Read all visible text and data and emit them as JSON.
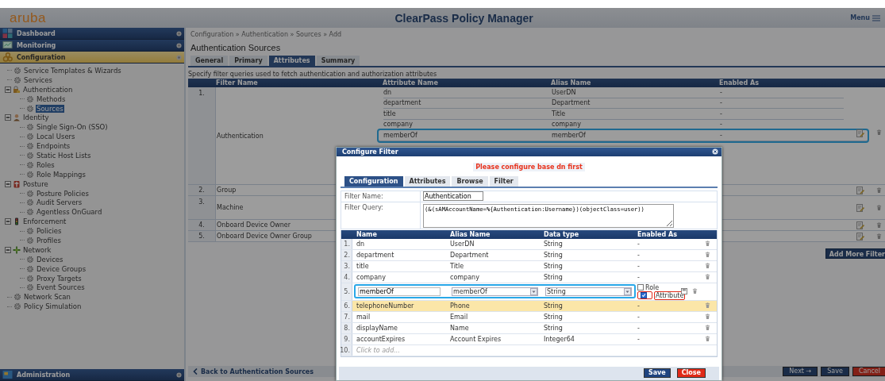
{
  "header": {
    "logo": "aruba",
    "title": "ClearPass Policy Manager",
    "menu": "Menu"
  },
  "nav": [
    {
      "label": "Dashboard",
      "selected": false
    },
    {
      "label": "Monitoring",
      "selected": false
    },
    {
      "label": "Configuration",
      "selected": true
    }
  ],
  "tree": [
    {
      "label": "Service Templates & Wizards",
      "selected": false
    },
    {
      "label": "Services",
      "selected": false
    },
    {
      "label": "Authentication",
      "selected": false,
      "expanded": true,
      "children": [
        {
          "label": "Methods",
          "selected": false
        },
        {
          "label": "Sources",
          "selected": true
        }
      ]
    },
    {
      "label": "Identity",
      "selected": false,
      "expanded": true,
      "children": [
        {
          "label": "Single Sign-On (SSO)",
          "selected": false
        },
        {
          "label": "Local Users",
          "selected": false
        },
        {
          "label": "Endpoints",
          "selected": false
        },
        {
          "label": "Static Host Lists",
          "selected": false
        },
        {
          "label": "Roles",
          "selected": false
        },
        {
          "label": "Role Mappings",
          "selected": false
        }
      ]
    },
    {
      "label": "Posture",
      "selected": false,
      "expanded": true,
      "children": [
        {
          "label": "Posture Policies",
          "selected": false
        },
        {
          "label": "Audit Servers",
          "selected": false
        },
        {
          "label": "Agentless OnGuard",
          "selected": false
        }
      ]
    },
    {
      "label": "Enforcement",
      "selected": false,
      "expanded": true,
      "children": [
        {
          "label": "Policies",
          "selected": false
        },
        {
          "label": "Profiles",
          "selected": false
        }
      ]
    },
    {
      "label": "Network",
      "selected": false,
      "expanded": true,
      "children": [
        {
          "label": "Devices",
          "selected": false
        },
        {
          "label": "Device Groups",
          "selected": false
        },
        {
          "label": "Proxy Targets",
          "selected": false
        },
        {
          "label": "Event Sources",
          "selected": false
        }
      ]
    },
    {
      "label": "Network Scan",
      "selected": false
    },
    {
      "label": "Policy Simulation",
      "selected": false
    }
  ],
  "nav_bottom": {
    "label": "Administration",
    "selected": false
  },
  "breadcrumb": "Configuration » Authentication » Sources » Add",
  "page_title": "Authentication Sources",
  "tabs": [
    {
      "label": "General",
      "selected": false
    },
    {
      "label": "Primary",
      "selected": false
    },
    {
      "label": "Attributes",
      "selected": true
    },
    {
      "label": "Summary",
      "selected": false
    }
  ],
  "description": "Specify filter queries used to fetch authentication and authorization attributes",
  "table": {
    "columns": [
      "Filter Name",
      "Attribute Name",
      "Alias Name",
      "Enabled As"
    ],
    "rows": [
      {
        "number": "1.",
        "filter_name": "Authentication",
        "attributes": [
          {
            "name": "dn",
            "alias": "UserDN",
            "enabled_as": "-",
            "highlighted": false
          },
          {
            "name": "department",
            "alias": "Department",
            "enabled_as": "-",
            "highlighted": false
          },
          {
            "name": "title",
            "alias": "Title",
            "enabled_as": "-",
            "highlighted": false
          },
          {
            "name": "company",
            "alias": "company",
            "enabled_as": "-",
            "highlighted": false
          },
          {
            "name": "memberOf",
            "alias": "memberOf",
            "enabled_as": "-",
            "highlighted": true
          }
        ]
      },
      {
        "number": "2.",
        "filter_name": "Group",
        "attributes": []
      },
      {
        "number": "3.",
        "filter_name": "Machine",
        "attributes": []
      },
      {
        "number": "4.",
        "filter_name": "Onboard Device Owner",
        "attributes": []
      },
      {
        "number": "5.",
        "filter_name": "Onboard Device Owner Group",
        "attributes": []
      }
    ]
  },
  "add_button": "Add More Filter",
  "back_link": "Back to Authentication Sources",
  "buttons": [
    {
      "label": "Next →",
      "kind": "next"
    },
    {
      "label": "Save",
      "kind": "save"
    },
    {
      "label": "Cancel",
      "kind": "cancel"
    }
  ],
  "dialog": {
    "title": "Configure Filter",
    "message": "Please configure base dn first",
    "tabs": [
      {
        "label": "Configuration",
        "selected": true
      },
      {
        "label": "Attributes",
        "selected": false
      },
      {
        "label": "Browse",
        "selected": false
      },
      {
        "label": "Filter",
        "selected": false
      }
    ],
    "filter_name_label": "Filter Name:",
    "filter_name": "Authentication",
    "filter_query_label": "Filter Query:",
    "filter_query": "(&(sAMAccountName=%{Authentication:Username})(objectClass=user))",
    "columns": [
      "Name",
      "Alias Name",
      "Data type",
      "Enabled As"
    ],
    "rows": [
      {
        "kind": "display",
        "number": "1.",
        "name": "dn",
        "alias": "UserDN",
        "data_type": "String",
        "enabled_as": "-",
        "selected": false
      },
      {
        "kind": "display",
        "number": "2.",
        "name": "department",
        "alias": "Department",
        "data_type": "String",
        "enabled_as": "-",
        "selected": false
      },
      {
        "kind": "display",
        "number": "3.",
        "name": "title",
        "alias": "Title",
        "data_type": "String",
        "enabled_as": "-",
        "selected": false
      },
      {
        "kind": "display",
        "number": "4.",
        "name": "company",
        "alias": "company",
        "data_type": "String",
        "enabled_as": "-",
        "selected": false
      },
      {
        "kind": "editing",
        "number": "5.",
        "name": "memberOf",
        "alias": "memberOf",
        "data_type": "String",
        "highlighted": true,
        "options": [
          {
            "label": "Role",
            "checked": false,
            "marked": false
          },
          {
            "label": "Attribute",
            "checked": true,
            "marked": true
          }
        ]
      },
      {
        "kind": "display",
        "number": "6.",
        "name": "telephoneNumber",
        "alias": "Phone",
        "data_type": "String",
        "enabled_as": "-",
        "selected": true
      },
      {
        "kind": "display",
        "number": "7.",
        "name": "mail",
        "alias": "Email",
        "data_type": "String",
        "enabled_as": "-",
        "selected": false
      },
      {
        "kind": "display",
        "number": "8.",
        "name": "displayName",
        "alias": "Name",
        "data_type": "String",
        "enabled_as": "-",
        "selected": false
      },
      {
        "kind": "display",
        "number": "9.",
        "name": "accountExpires",
        "alias": "Account Expires",
        "data_type": "Integer64",
        "enabled_as": "-",
        "selected": false
      },
      {
        "kind": "add",
        "number": "10.",
        "placeholder": "Click to add..."
      }
    ],
    "buttons": [
      {
        "label": "Save",
        "kind": "save"
      },
      {
        "label": "Close",
        "kind": "close"
      }
    ]
  }
}
